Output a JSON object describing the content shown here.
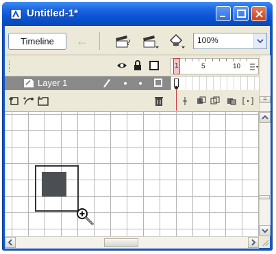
{
  "window": {
    "title": "Untitled-1*"
  },
  "toolbar": {
    "timeline_label": "Timeline",
    "zoom_value": "100%",
    "icons": [
      "back-arrow-icon",
      "edit-scene-icon",
      "edit-symbols-icon",
      "stage-view-icon"
    ]
  },
  "timeline": {
    "ruler_numbers": [
      "1",
      "5",
      "10"
    ],
    "current_frame": "1",
    "layer": {
      "name": "Layer 1"
    }
  },
  "colors": {
    "title_bar": "#0a55d6",
    "layer_row_bg": "#8a8a8a",
    "shape_fill": "#4b4e52",
    "playhead": "#c83c3c"
  }
}
